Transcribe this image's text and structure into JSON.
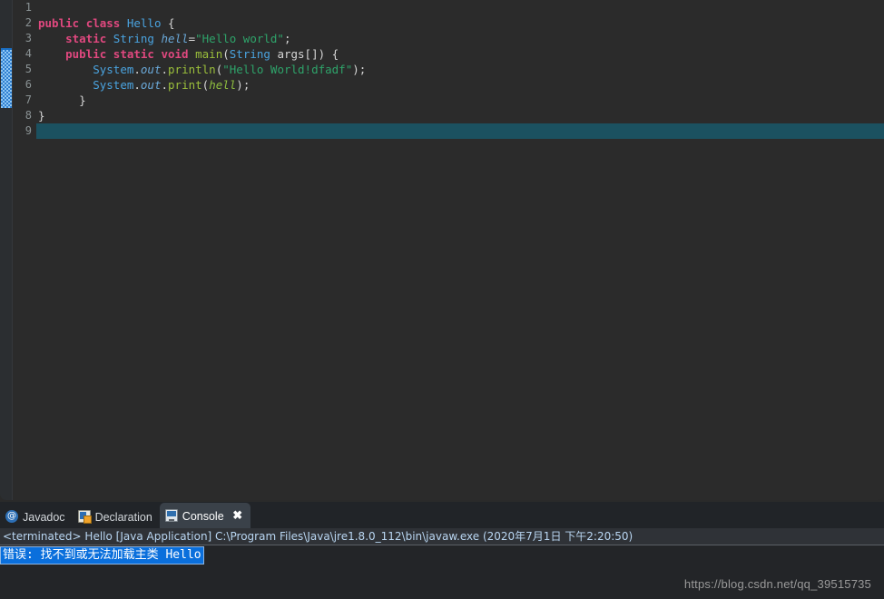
{
  "editor": {
    "name": "java-source-editor",
    "line_numbers": [
      "1",
      "2",
      "3",
      "4",
      "5",
      "6",
      "7",
      "8",
      "9"
    ],
    "current_line": 9,
    "folding_marker_line": 4,
    "method_range_lines": [
      4,
      7
    ],
    "code_lines": [
      {
        "number": "1",
        "tokens": []
      },
      {
        "number": "2",
        "tokens": [
          {
            "t": "public",
            "c": "tok-keyword"
          },
          {
            "t": " ",
            "c": "tok-plain"
          },
          {
            "t": "class",
            "c": "tok-keyword"
          },
          {
            "t": " ",
            "c": "tok-plain"
          },
          {
            "t": "Hello",
            "c": "tok-type"
          },
          {
            "t": " {",
            "c": "tok-plain"
          }
        ]
      },
      {
        "number": "3",
        "tokens": [
          {
            "t": "    ",
            "c": "tok-plain"
          },
          {
            "t": "static",
            "c": "tok-keyword"
          },
          {
            "t": " ",
            "c": "tok-plain"
          },
          {
            "t": "String",
            "c": "tok-type"
          },
          {
            "t": " ",
            "c": "tok-plain"
          },
          {
            "t": "hell",
            "c": "tok-field"
          },
          {
            "t": "=",
            "c": "tok-plain"
          },
          {
            "t": "\"Hello world\"",
            "c": "tok-string"
          },
          {
            "t": ";",
            "c": "tok-plain"
          }
        ]
      },
      {
        "number": "4",
        "tokens": [
          {
            "t": "    ",
            "c": "tok-plain"
          },
          {
            "t": "public",
            "c": "tok-keyword"
          },
          {
            "t": " ",
            "c": "tok-plain"
          },
          {
            "t": "static",
            "c": "tok-keyword"
          },
          {
            "t": " ",
            "c": "tok-plain"
          },
          {
            "t": "void",
            "c": "tok-keyword"
          },
          {
            "t": " ",
            "c": "tok-plain"
          },
          {
            "t": "main",
            "c": "tok-method"
          },
          {
            "t": "(",
            "c": "tok-plain"
          },
          {
            "t": "String",
            "c": "tok-type"
          },
          {
            "t": " args[]) {",
            "c": "tok-plain"
          }
        ]
      },
      {
        "number": "5",
        "tokens": [
          {
            "t": "        ",
            "c": "tok-plain"
          },
          {
            "t": "System",
            "c": "tok-type"
          },
          {
            "t": ".",
            "c": "tok-plain"
          },
          {
            "t": "out",
            "c": "tok-field"
          },
          {
            "t": ".",
            "c": "tok-plain"
          },
          {
            "t": "println",
            "c": "tok-method"
          },
          {
            "t": "(",
            "c": "tok-plain"
          },
          {
            "t": "\"Hello World!dfadf\"",
            "c": "tok-string"
          },
          {
            "t": ");",
            "c": "tok-plain"
          }
        ]
      },
      {
        "number": "6",
        "tokens": [
          {
            "t": "        ",
            "c": "tok-plain"
          },
          {
            "t": "System",
            "c": "tok-type"
          },
          {
            "t": ".",
            "c": "tok-plain"
          },
          {
            "t": "out",
            "c": "tok-field"
          },
          {
            "t": ".",
            "c": "tok-plain"
          },
          {
            "t": "print",
            "c": "tok-method"
          },
          {
            "t": "(",
            "c": "tok-plain"
          },
          {
            "t": "hell",
            "c": "tok-var"
          },
          {
            "t": ");",
            "c": "tok-plain"
          }
        ]
      },
      {
        "number": "7",
        "tokens": [
          {
            "t": "      }",
            "c": "tok-plain"
          }
        ]
      },
      {
        "number": "8",
        "tokens": [
          {
            "t": "}",
            "c": "tok-plain"
          }
        ]
      },
      {
        "number": "9",
        "tokens": []
      }
    ]
  },
  "bottom_view": {
    "tabs": [
      {
        "label": "Javadoc",
        "icon": "javadoc-at-icon",
        "active": false,
        "closable": false
      },
      {
        "label": "Declaration",
        "icon": "declaration-document-icon",
        "active": false,
        "closable": false
      },
      {
        "label": "Console",
        "icon": "console-monitor-icon",
        "active": true,
        "closable": true
      }
    ],
    "close_glyph": "✖",
    "javadoc_glyph": "@"
  },
  "console": {
    "launch_line": "<terminated> Hello [Java Application] C:\\Program Files\\Java\\jre1.8.0_112\\bin\\javaw.exe (2020年7月1日 下午2:20:50)",
    "output_lines": [
      {
        "text": "错误: 找不到或无法加载主类 Hello",
        "selected": true
      }
    ]
  },
  "watermark": {
    "text": "https://blog.csdn.net/qq_39515735"
  },
  "colors": {
    "editor_background": "#2b2b2b",
    "current_line_highlight": "#1b5160",
    "keyword": "#e0487f",
    "type": "#4aa3df",
    "string": "#2ea36a",
    "method": "#9bbf3b",
    "field_italic": "#6aa8d8",
    "line_number": "#8a9294",
    "console_selection": "#0a6fdc",
    "launch_text": "#b9d6f2",
    "active_tab_background": "#3a4149",
    "annotation_marker": "#2f7fd0"
  }
}
